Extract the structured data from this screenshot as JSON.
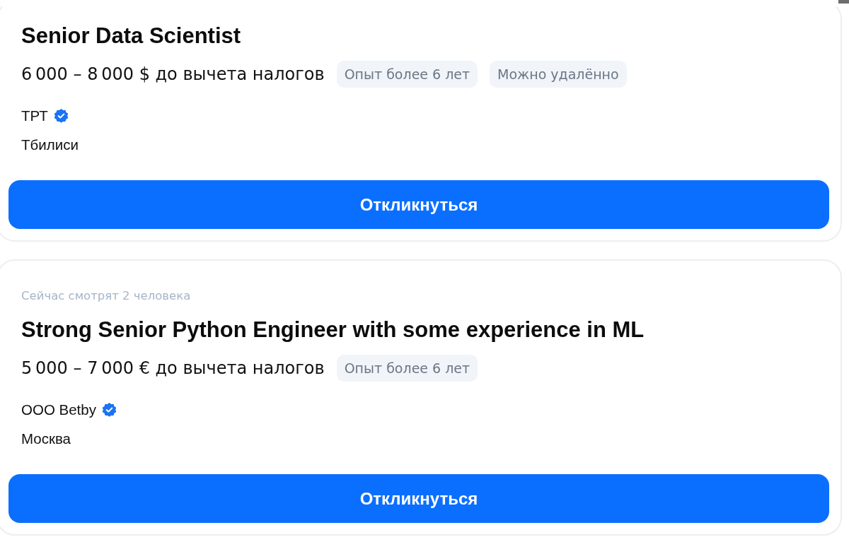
{
  "vacancies": [
    {
      "title": "Senior Data Scientist",
      "salary": "6 000 – 8 000 $ до вычета налогов",
      "tags": [
        "Опыт более 6 лет",
        "Можно удалённо"
      ],
      "company": "ТРТ",
      "verified": true,
      "city": "Тбилиси",
      "button": "Откликнуться"
    },
    {
      "viewers_note": "Сейчас смотрят 2 человека",
      "title": "Strong Senior Python Engineer with some experience in ML",
      "salary": "5 000 – 7 000 € до вычета налогов",
      "tags": [
        "Опыт более 6 лет"
      ],
      "company": "ООО Betby",
      "verified": true,
      "city": "Москва",
      "button": "Откликнуться"
    }
  ]
}
